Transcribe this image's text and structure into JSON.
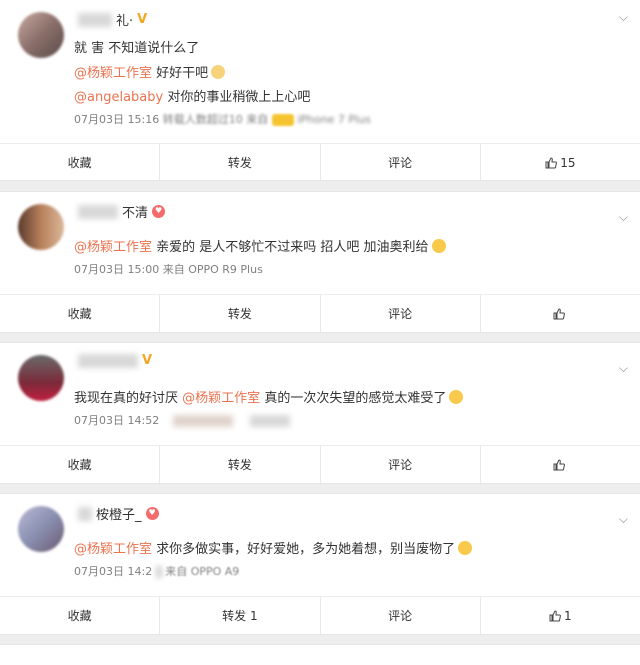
{
  "comments": [
    {
      "username_suffix": "礼·",
      "badge": "V",
      "line1_plain": "就 害 不知道说什么了",
      "line2_mention": "@杨颖工作室",
      "line2_text": "好好干吧",
      "line3_mention": "@angelababy",
      "line3_text": "对你的事业稍微上上心吧",
      "meta_time": "07月03日 15:16",
      "meta_rest": "转载人数超过10  来自",
      "meta_device": "iPhone 7 Plus",
      "actions": {
        "collect": "收藏",
        "repost": "转发",
        "comment": "评论",
        "like": "15"
      }
    },
    {
      "username_suffix": "不清",
      "line1_mention": "@杨颖工作室",
      "line1_text": "亲爱的 是人不够忙不过来吗 招人吧 加油奥利给",
      "meta_time": "07月03日 15:00",
      "meta_rest": "来自 OPPO R9 Plus",
      "actions": {
        "collect": "收藏",
        "repost": "转发",
        "comment": "评论",
        "like": ""
      }
    },
    {
      "badge": "V",
      "line1_text_a": "我现在真的好讨厌",
      "line1_mention": "@杨颖工作室",
      "line1_text_b": "真的一次次失望的感觉太难受了",
      "meta_time": "07月03日 14:52",
      "actions": {
        "collect": "收藏",
        "repost": "转发",
        "comment": "评论",
        "like": ""
      }
    },
    {
      "username_suffix": "桉橙子_",
      "line1_mention": "@杨颖工作室",
      "line1_text": "求你多做实事，好好爱她，多为她着想，别当废物了",
      "meta_time": "07月03日 14:2",
      "meta_rest": "来自 OPPO A9",
      "actions": {
        "collect": "收藏",
        "repost": "转发 1",
        "comment": "评论",
        "like": "1"
      }
    }
  ],
  "icons": {
    "chevron": "chevron-down-icon",
    "like": "thumbs-up-icon"
  }
}
